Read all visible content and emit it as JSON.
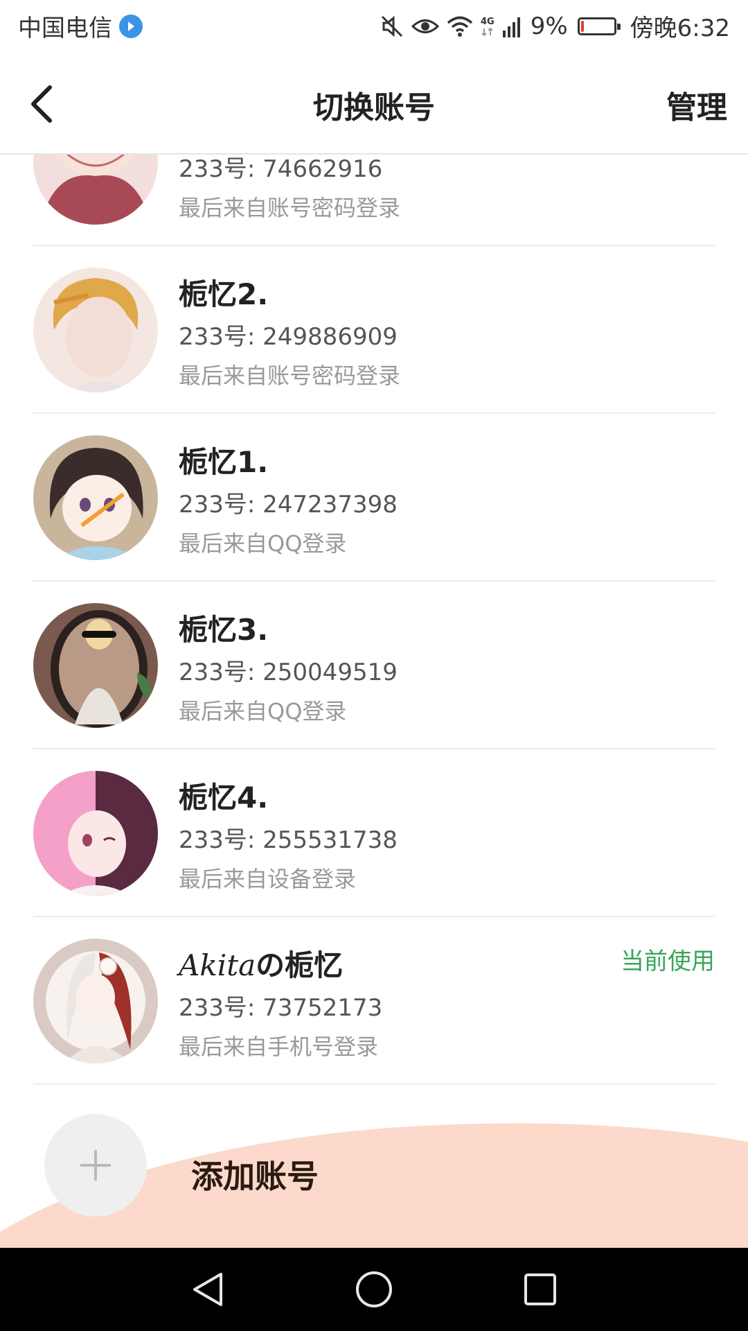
{
  "status_bar": {
    "carrier": "中国电信",
    "carrier_badge_icon": "hd-badge-icon",
    "battery_percent": "9%",
    "battery_level": 0.09,
    "time": "傍晚6:32",
    "icons": [
      "mute-icon",
      "eye-icon",
      "wifi-icon",
      "4g-icon",
      "signal-icon",
      "battery-icon"
    ]
  },
  "header": {
    "back_icon": "chevron-left-icon",
    "title": "切换账号",
    "manage_label": "管理"
  },
  "accounts": [
    {
      "name": "",
      "id_text": "233号: 74662916",
      "source_text": "最后来自账号密码登录",
      "current_label": ""
    },
    {
      "name": "栀忆2.",
      "id_text": "233号: 249886909",
      "source_text": "最后来自账号密码登录",
      "current_label": ""
    },
    {
      "name": "栀忆1.",
      "id_text": "233号: 247237398",
      "source_text": "最后来自QQ登录",
      "current_label": ""
    },
    {
      "name": "栀忆3.",
      "id_text": "233号: 250049519",
      "source_text": "最后来自QQ登录",
      "current_label": ""
    },
    {
      "name": "栀忆4.",
      "id_text": "233号: 255531738",
      "source_text": "最后来自设备登录",
      "current_label": ""
    },
    {
      "name_italic": "Akita",
      "name_rest": "の栀忆",
      "id_text": "233号: 73752173",
      "source_text": "最后来自手机号登录",
      "current_label": "当前使用"
    }
  ],
  "add_account": {
    "label": "添加账号",
    "icon": "plus-icon"
  },
  "colors": {
    "current_green": "#3aa55a",
    "wave_peach": "#fcd9cb",
    "battery_red": "#e53935"
  },
  "nav_bar": {
    "icons": [
      "back-triangle-icon",
      "home-circle-icon",
      "recents-square-icon"
    ]
  }
}
